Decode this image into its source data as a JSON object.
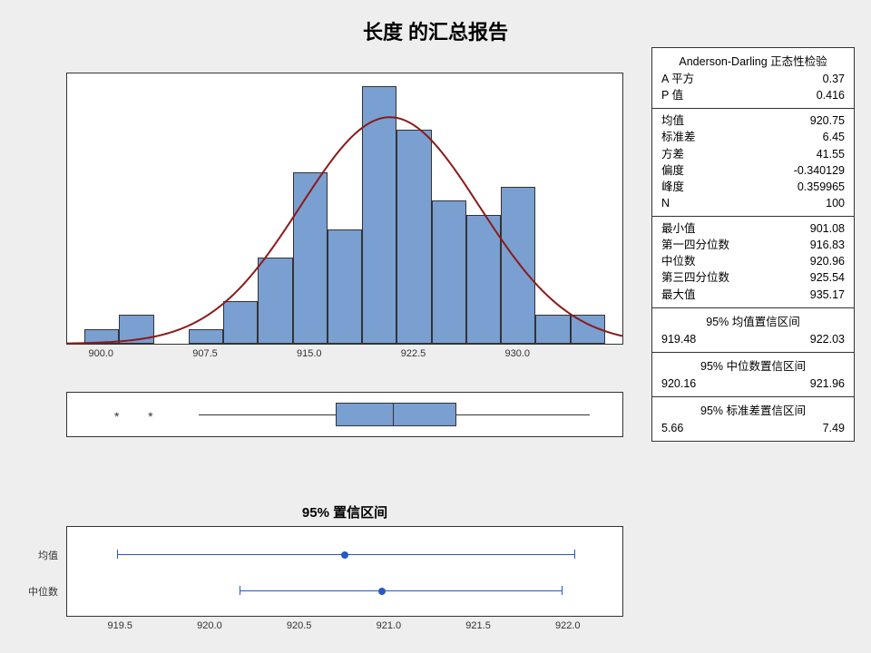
{
  "title": "长度 的汇总报告",
  "chart_data": {
    "histogram": {
      "type": "bar",
      "xrange": [
        897.5,
        937.5
      ],
      "bin_width": 2.5,
      "bin_centers": [
        900.0,
        902.5,
        905.0,
        907.5,
        910.0,
        912.5,
        915.0,
        917.5,
        920.0,
        922.5,
        925.0,
        927.5,
        930.0,
        932.5,
        935.0
      ],
      "counts": [
        1,
        2,
        0,
        1,
        3,
        6,
        12,
        8,
        18,
        15,
        10,
        9,
        11,
        2,
        2
      ],
      "xticks": [
        900.0,
        907.5,
        915.0,
        922.5,
        930.0
      ],
      "ylabel": "",
      "normal_curve": true
    },
    "boxplot": {
      "xrange": [
        897.5,
        937.5
      ],
      "min": 907.0,
      "q1": 916.83,
      "median": 920.96,
      "q3": 925.54,
      "max": 935.17,
      "outliers": [
        901.08,
        903.5
      ]
    },
    "ci": {
      "title": "95% 置信区间",
      "xrange": [
        919.2,
        922.3
      ],
      "xticks": [
        919.5,
        920.0,
        920.5,
        921.0,
        921.5,
        922.0
      ],
      "rows": [
        {
          "label": "均值",
          "low": 919.48,
          "mid": 920.75,
          "high": 922.03
        },
        {
          "label": "中位数",
          "low": 920.16,
          "mid": 920.96,
          "high": 921.96
        }
      ]
    }
  },
  "stats": {
    "ad_header": "Anderson-Darling 正态性检验",
    "ad": {
      "a2_label": "A 平方",
      "a2": "0.37",
      "p_label": "P 值",
      "p": "0.416"
    },
    "moments": [
      {
        "label": "均值",
        "value": "920.75"
      },
      {
        "label": "标准差",
        "value": "6.45"
      },
      {
        "label": "方差",
        "value": "41.55"
      },
      {
        "label": "偏度",
        "value": "-0.340129"
      },
      {
        "label": "峰度",
        "value": "0.359965"
      },
      {
        "label": "N",
        "value": "100"
      }
    ],
    "quartiles": [
      {
        "label": "最小值",
        "value": "901.08"
      },
      {
        "label": "第一四分位数",
        "value": "916.83"
      },
      {
        "label": "中位数",
        "value": "920.96"
      },
      {
        "label": "第三四分位数",
        "value": "925.54"
      },
      {
        "label": "最大值",
        "value": "935.17"
      }
    ],
    "ci_mean": {
      "header": "95% 均值置信区间",
      "low": "919.48",
      "high": "922.03"
    },
    "ci_median": {
      "header": "95% 中位数置信区间",
      "low": "920.16",
      "high": "921.96"
    },
    "ci_std": {
      "header": "95% 标准差置信区间",
      "low": "5.66",
      "high": "7.49"
    }
  }
}
